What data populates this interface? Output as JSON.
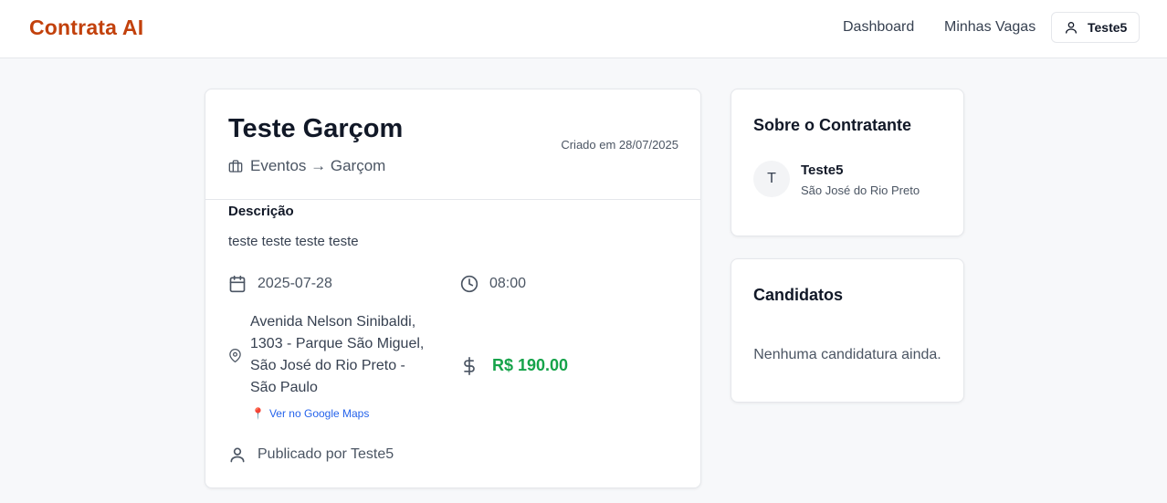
{
  "header": {
    "brand": "Contrata AI",
    "nav": {
      "dashboard": "Dashboard",
      "my_jobs": "Minhas Vagas"
    },
    "user_label": "Teste5"
  },
  "job": {
    "title": "Teste Garçom",
    "created": "Criado em 28/07/2025",
    "category": "Eventos → Garçom",
    "description_label": "Descrição",
    "description": "teste teste teste teste",
    "date": "2025-07-28",
    "time": "08:00",
    "address": "Avenida Nelson Sinibaldi, 1303 - Parque São Miguel, São José do Rio Preto - São Paulo",
    "maps_link": "Ver no Google Maps",
    "price": "R$ 190.00",
    "published_by": "Publicado por Teste5"
  },
  "owner": {
    "section_title": "Sobre o Contratante",
    "avatar_initial": "T",
    "name": "Teste5",
    "city": "São José do Rio Preto"
  },
  "candidates": {
    "section_title": "Candidatos",
    "empty_text": "Nenhuma candidatura ainda."
  },
  "colors": {
    "brand": "#c2410c",
    "price": "#16a34a",
    "link": "#2563eb"
  }
}
